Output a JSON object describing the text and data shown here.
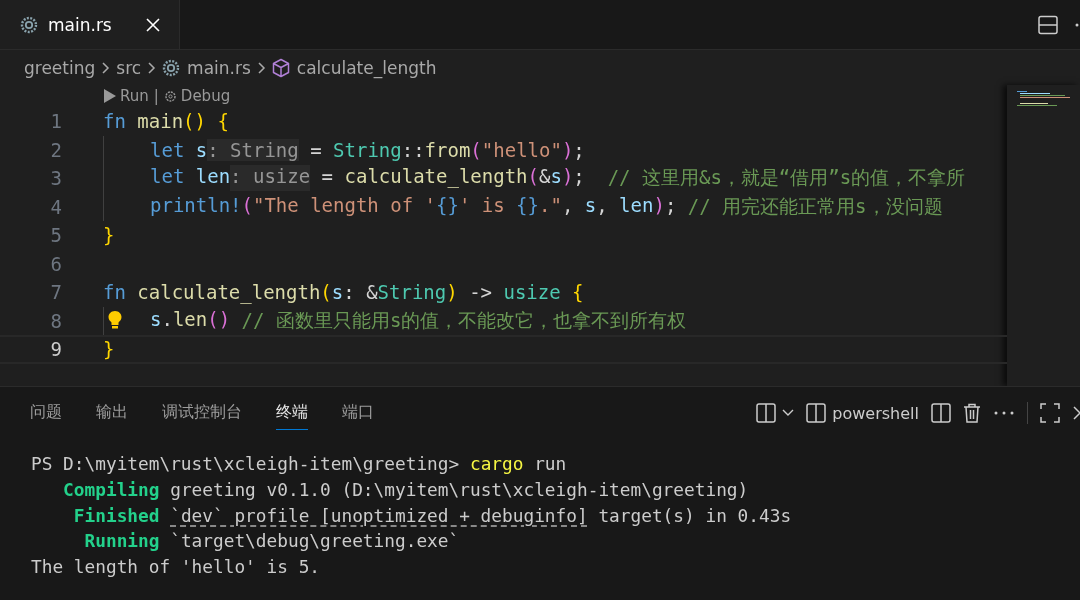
{
  "editor_tabs": [
    {
      "label": "main.rs",
      "selected": true
    }
  ],
  "breadcrumb": [
    {
      "label": "greeting",
      "kind": "folder"
    },
    {
      "label": "src",
      "kind": "folder"
    },
    {
      "label": "main.rs",
      "kind": "file"
    },
    {
      "label": "calculate_length",
      "kind": "symbol"
    }
  ],
  "codelens": {
    "run": "Run",
    "separator": "|",
    "debug": "Debug"
  },
  "editor": {
    "lines": [
      {
        "number": "1",
        "current": false,
        "indented": false,
        "tokens": [
          {
            "kind": "keyword",
            "text": "fn "
          },
          {
            "kind": "function",
            "text": "main"
          },
          {
            "kind": "bracket1",
            "text": "() "
          },
          {
            "kind": "bracket1",
            "text": "{"
          }
        ]
      },
      {
        "number": "2",
        "current": false,
        "indented": true,
        "tokens": [
          {
            "kind": "keyword",
            "text": "let "
          },
          {
            "kind": "variable",
            "text": "s"
          },
          {
            "kind": "hint",
            "text": ": String"
          },
          {
            "kind": "plain",
            "text": " = "
          },
          {
            "kind": "type",
            "text": "String"
          },
          {
            "kind": "plain",
            "text": "::"
          },
          {
            "kind": "function",
            "text": "from"
          },
          {
            "kind": "bracket2",
            "text": "("
          },
          {
            "kind": "string",
            "text": "\"hello\""
          },
          {
            "kind": "bracket2",
            "text": ")"
          },
          {
            "kind": "plain",
            "text": ";"
          }
        ]
      },
      {
        "number": "3",
        "current": false,
        "indented": true,
        "tokens": [
          {
            "kind": "keyword",
            "text": "let "
          },
          {
            "kind": "variable",
            "text": "len"
          },
          {
            "kind": "hint",
            "text": ": usize"
          },
          {
            "kind": "plain",
            "text": " = "
          },
          {
            "kind": "function",
            "text": "calculate_length"
          },
          {
            "kind": "bracket2",
            "text": "("
          },
          {
            "kind": "plain",
            "text": "&"
          },
          {
            "kind": "variable",
            "text": "s"
          },
          {
            "kind": "bracket2",
            "text": ")"
          },
          {
            "kind": "plain",
            "text": ";  "
          },
          {
            "kind": "comment",
            "text": "// 这里用&s，就是“借用”s的值，不拿所"
          }
        ]
      },
      {
        "number": "4",
        "current": false,
        "indented": true,
        "tokens": [
          {
            "kind": "macro",
            "text": "println!"
          },
          {
            "kind": "bracket2",
            "text": "("
          },
          {
            "kind": "string",
            "text": "\"The length of '"
          },
          {
            "kind": "placeholder",
            "text": "{}"
          },
          {
            "kind": "string",
            "text": "' is "
          },
          {
            "kind": "placeholder",
            "text": "{}"
          },
          {
            "kind": "string",
            "text": ".\""
          },
          {
            "kind": "plain",
            "text": ", "
          },
          {
            "kind": "variable",
            "text": "s"
          },
          {
            "kind": "plain",
            "text": ", "
          },
          {
            "kind": "variable",
            "text": "len"
          },
          {
            "kind": "bracket2",
            "text": ")"
          },
          {
            "kind": "plain",
            "text": "; "
          },
          {
            "kind": "comment",
            "text": "// 用完还能正常用s，没问题"
          }
        ]
      },
      {
        "number": "5",
        "current": false,
        "indented": false,
        "tokens": [
          {
            "kind": "bracket1",
            "text": "}"
          }
        ]
      },
      {
        "number": "6",
        "current": false,
        "indented": false
      },
      {
        "number": "7",
        "current": false,
        "indented": false,
        "tokens": [
          {
            "kind": "keyword",
            "text": "fn "
          },
          {
            "kind": "function",
            "text": "calculate_length"
          },
          {
            "kind": "bracket1",
            "text": "("
          },
          {
            "kind": "variable",
            "text": "s"
          },
          {
            "kind": "plain",
            "text": ": &"
          },
          {
            "kind": "type",
            "text": "String"
          },
          {
            "kind": "bracket1",
            "text": ")"
          },
          {
            "kind": "plain",
            "text": " -> "
          },
          {
            "kind": "type",
            "text": "usize "
          },
          {
            "kind": "bracket1",
            "text": "{"
          }
        ]
      },
      {
        "number": "8",
        "current": false,
        "indented": true,
        "lightbulb": true,
        "tokens": [
          {
            "kind": "variable",
            "text": "s"
          },
          {
            "kind": "plain",
            "text": "."
          },
          {
            "kind": "function",
            "text": "len"
          },
          {
            "kind": "bracket2",
            "text": "() "
          },
          {
            "kind": "comment",
            "text": "// 函数里只能用s的值，不能改它，也拿不到所有权"
          }
        ]
      },
      {
        "number": "9",
        "current": true,
        "indented": false,
        "tokens": [
          {
            "kind": "bracket1",
            "text": "}"
          }
        ]
      }
    ]
  },
  "panel": {
    "tabs": [
      {
        "label": "问题",
        "selected": false
      },
      {
        "label": "输出",
        "selected": false
      },
      {
        "label": "调试控制台",
        "selected": false
      },
      {
        "label": "终端",
        "selected": true
      },
      {
        "label": "端口",
        "selected": false
      }
    ],
    "terminal_name": "powershell",
    "terminal_lines": [
      [
        {
          "kind": "plain",
          "text": "PS D:\\myitem\\rust\\xcleigh-item\\greeting> "
        },
        {
          "kind": "command",
          "text": "cargo"
        },
        {
          "kind": "plain",
          "text": " run"
        }
      ],
      [
        {
          "kind": "status",
          "text": "   Compiling"
        },
        {
          "kind": "plain",
          "text": " greeting v0.1.0 (D:\\myitem\\rust\\xcleigh-item\\greeting)"
        }
      ],
      [
        {
          "kind": "status",
          "text": "    Finished "
        },
        {
          "kind": "link",
          "text": "`dev` profile [unoptimized + debuginfo]"
        },
        {
          "kind": "plain",
          "text": " target(s) in 0.43s"
        }
      ],
      [
        {
          "kind": "status",
          "text": "     Running"
        },
        {
          "kind": "plain",
          "text": " `target\\debug\\greeting.exe`"
        }
      ],
      [
        {
          "kind": "plain",
          "text": "The length of 'hello' is 5."
        }
      ]
    ]
  }
}
